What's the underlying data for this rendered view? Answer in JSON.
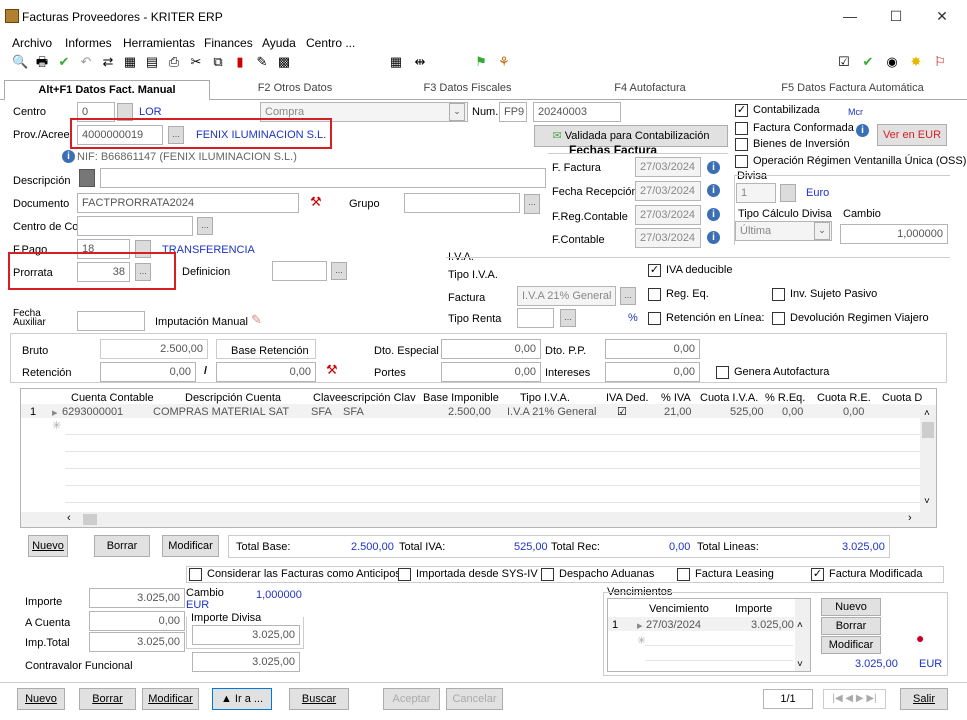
{
  "window": {
    "title": "Facturas Proveedores  - KRITER ERP",
    "minimize": "—",
    "maximize": "☐",
    "close": "✕"
  },
  "menu": [
    "Archivo",
    "Informes",
    "Herramientas",
    "Finances",
    "Ayuda",
    "Centro ..."
  ],
  "tabs": [
    "Alt+F1 Datos Fact. Manual",
    "F2 Otros Datos",
    "F3 Datos Fiscales",
    "F4 Autofactura",
    "F5 Datos Factura Automática"
  ],
  "form": {
    "centro_label": "Centro",
    "centro_value": "0",
    "centro_code": "LOR",
    "compra": "Compra",
    "num_label": "Num.",
    "num_series": "FP9",
    "num_value": "20240003",
    "prov_label": "Prov./Acree",
    "prov_code": "4000000019",
    "prov_name": "FENIX ILUMINACION S.L.",
    "nif": "NIF: B66861147 (FENIX ILUMINACION S.L.)",
    "validada": "Validada para Contabilización",
    "desc_label": "Descripción",
    "doc_label": "Documento",
    "doc_value": "FACTPRORRATA2024",
    "grupo_label": "Grupo",
    "centro_co_label": "Centro de Co",
    "fpago_label": "F.Pago",
    "fpago_code": "18",
    "fpago_name": "TRANSFERENCIA",
    "prorrata_label": "Prorrata",
    "prorrata_value": "38",
    "definicion_label": "Definicion",
    "fecha_aux_label1": "Fecha",
    "fecha_aux_label2": "Auxiliar",
    "imputacion": "Imputación Manual"
  },
  "fechas": {
    "title": "Fechas Factura",
    "f_factura_label": "F. Factura",
    "f_factura": "27/03/2024",
    "f_recep_label": "Fecha Recepción",
    "f_recep": "27/03/2024",
    "f_reg_label": "F.Reg.Contable",
    "f_reg": "27/03/2024",
    "f_cont_label": "F.Contable",
    "f_cont": "27/03/2024"
  },
  "status": {
    "contabilizada": "Contabilizada",
    "mcr": "Mcr",
    "factura_conformada": "Factura Conformada",
    "bienes_inversion": "Bienes de Inversión",
    "ver_eur": "Ver en EUR",
    "oss": "Operación Régimen Ventanilla Única (OSS)",
    "divisa_label": "Divisa",
    "divisa_code": "1",
    "divisa_name": "Euro",
    "tipo_calc_label": "Tipo Cálculo Divisa",
    "cambio_label": "Cambio",
    "tipo_calc_value": "Última",
    "cambio_value": "1,000000"
  },
  "iva": {
    "group": "I.V.A.",
    "tipo_label": "Tipo I.V.A.",
    "iva_deducible": "IVA deducible",
    "factura_label": "Factura",
    "factura_value": "I.V.A 21% General",
    "reg_eq": "Reg. Eq.",
    "inv_sujeto": "Inv. Sujeto Pasivo",
    "tipo_renta_label": "Tipo Renta",
    "pct": "%",
    "retencion_linea": "Retención en Línea:",
    "devolucion": "Devolución Regimen Viajero"
  },
  "totals_top": {
    "bruto_label": "Bruto",
    "bruto": "2.500,00",
    "base_ret": "Base Retención",
    "dto_esp_label": "Dto. Especial",
    "dto_esp": "0,00",
    "dto_pp_label": "Dto. P.P.",
    "dto_pp": "0,00",
    "retencion_label": "Retención",
    "retencion": "0,00",
    "retencion2": "0,00",
    "portes_label": "Portes",
    "portes": "0,00",
    "intereses_label": "Intereses",
    "intereses": "0,00",
    "genera_auto": "Genera Autofactura"
  },
  "grid": {
    "headers": [
      "Cuenta Contable",
      "Descripción Cuenta",
      "Clave",
      "escripción Clav",
      "Base Imponible",
      "Tipo I.V.A.",
      "IVA Ded.",
      "% IVA",
      "Cuota I.V.A.",
      "% R.Eq.",
      "Cuota R.E.",
      "Cuota D"
    ],
    "row": {
      "num": "1",
      "cuenta": "6293000001",
      "desc": "COMPRAS MATERIAL SAT",
      "clave": "SFA",
      "desc_clave": "SFA",
      "base": "2.500,00",
      "tipo": "I.V.A 21% General",
      "iva_ded": "☑",
      "pct_iva": "21,00",
      "cuota_iva": "525,00",
      "pct_req": "0,00",
      "cuota_re": "0,00"
    }
  },
  "grid_buttons": {
    "nuevo": "Nuevo",
    "borrar": "Borrar",
    "modificar": "Modificar"
  },
  "grid_totals": {
    "total_base_label": "Total Base:",
    "total_base": "2.500,00",
    "total_iva_label": "Total IVA:",
    "total_iva": "525,00",
    "total_rec_label": "Total Rec:",
    "total_rec": "0,00",
    "total_lineas_label": "Total Lineas:",
    "total_lineas": "3.025,00"
  },
  "flags": {
    "anticipos": "Considerar las Facturas como Anticipos",
    "importada": "Importada desde SYS-IV",
    "despacho": "Despacho Aduanas",
    "leasing": "Factura Leasing",
    "modificada": "Factura Modificada"
  },
  "bottom": {
    "importe_label": "Importe",
    "importe": "3.025,00",
    "cambio_label": "Cambio",
    "eur": "EUR",
    "cambio_value": "1,000000",
    "a_cuenta_label": "A Cuenta",
    "a_cuenta": "0,00",
    "importe_divisa_label": "Importe Divisa",
    "importe_divisa": "3.025,00",
    "imp_total_label": "Imp.Total",
    "imp_total": "3.025,00",
    "contravalor_label": "Contravalor Funcional",
    "contravalor": "3.025,00"
  },
  "vencimientos": {
    "title": "Vencimientos",
    "col_venc": "Vencimiento",
    "col_imp": "Importe",
    "row_num": "1",
    "fecha": "27/03/2024",
    "importe": "3.025,00",
    "nuevo": "Nuevo",
    "borrar": "Borrar",
    "modificar": "Modificar",
    "total": "3.025,00",
    "total_cur": "EUR"
  },
  "footer": {
    "nuevo": "Nuevo",
    "borrar": "Borrar",
    "modificar": "Modificar",
    "ira": "▲ Ir a ...",
    "buscar": "Buscar",
    "aceptar": "Aceptar",
    "cancelar": "Cancelar",
    "page": "1/1",
    "salir": "Salir"
  }
}
